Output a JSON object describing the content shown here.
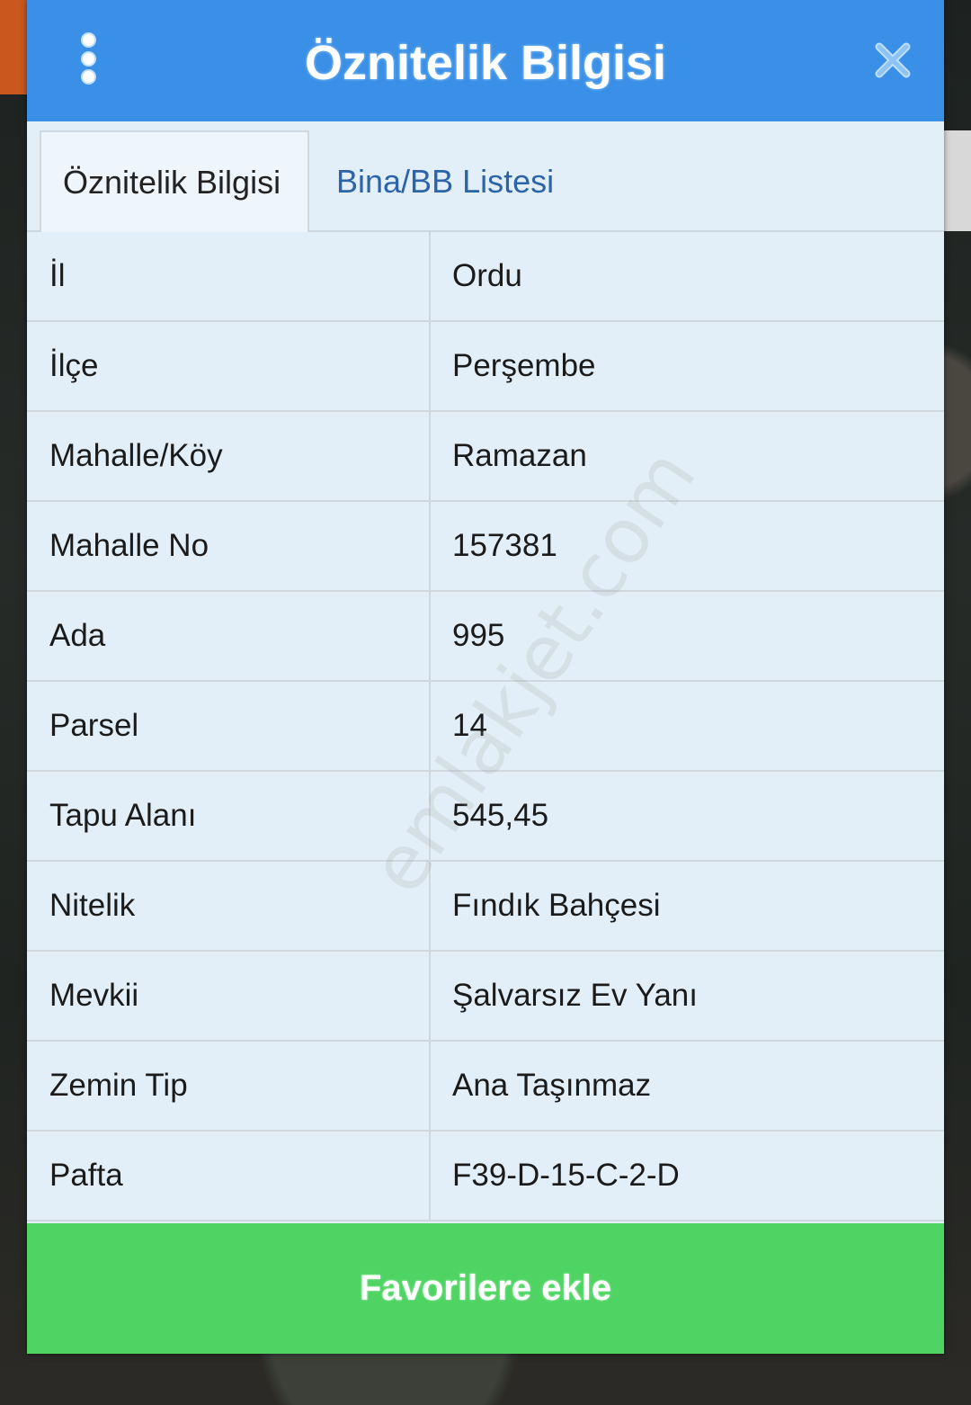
{
  "window": {
    "title": "Öznitelik Bilgisi",
    "menu_icon": "more-vertical-icon",
    "close_icon": "close-icon",
    "accent": "#3a8fe6"
  },
  "tabs": [
    {
      "label": "Öznitelik Bilgisi",
      "active": true
    },
    {
      "label": "Bina/BB Listesi",
      "active": false
    }
  ],
  "attributes": [
    {
      "key": "İl",
      "value": "Ordu"
    },
    {
      "key": "İlçe",
      "value": "Perşembe"
    },
    {
      "key": "Mahalle/Köy",
      "value": "Ramazan"
    },
    {
      "key": "Mahalle No",
      "value": "157381"
    },
    {
      "key": "Ada",
      "value": "995"
    },
    {
      "key": "Parsel",
      "value": "14"
    },
    {
      "key": "Tapu Alanı",
      "value": "545,45"
    },
    {
      "key": "Nitelik",
      "value": "Fındık Bahçesi"
    },
    {
      "key": "Mevkii",
      "value": "Şalvarsız Ev Yanı"
    },
    {
      "key": "Zemin Tip",
      "value": "Ana Taşınmaz"
    },
    {
      "key": "Pafta",
      "value": "F39-D-15-C-2-D"
    }
  ],
  "footer": {
    "favorite_label": "Favorilere ekle",
    "button_color": "#4fd463"
  },
  "watermark": "emlakjet.com"
}
